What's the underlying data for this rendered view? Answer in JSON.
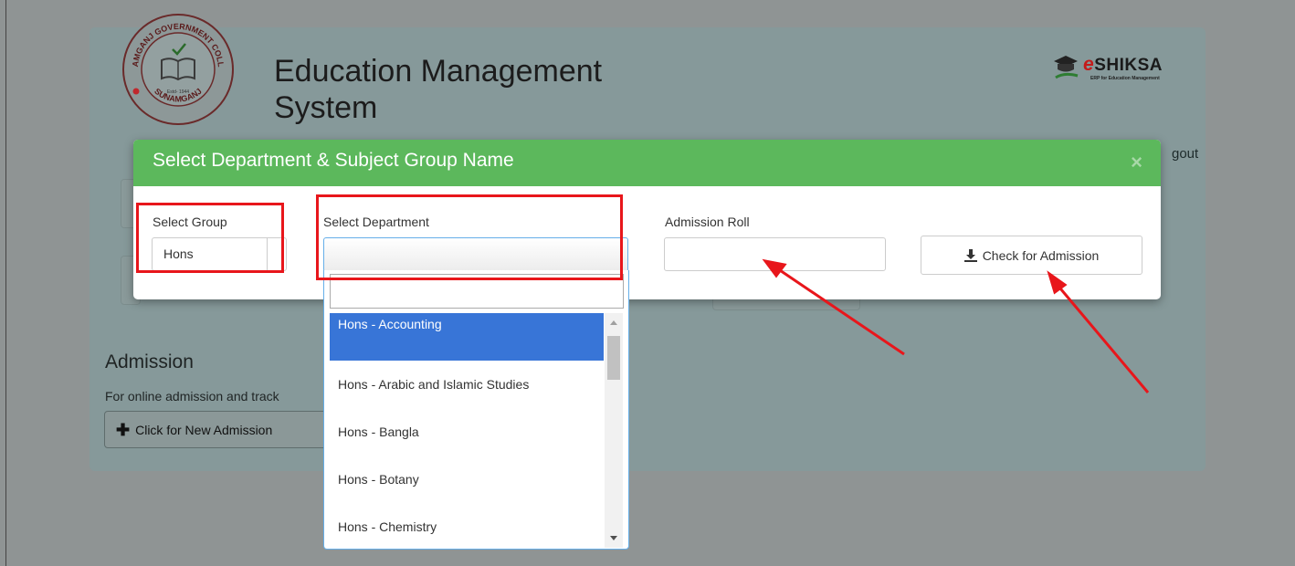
{
  "app": {
    "title": "Education Management System",
    "logout_label": "gout",
    "logo": {
      "top_text": "SUNAMGANJ GOVERNMENT COLLEGE",
      "bottom_text": "SUNAMGANJ",
      "established": "Estd- 1944"
    },
    "brand": {
      "name_prefix": "e",
      "name_rest": "SHIKSA",
      "tagline": "ERP for Education Management"
    }
  },
  "admission": {
    "heading": "Admission",
    "description": "For online admission and track",
    "new_admission_button": "Click for New Admission"
  },
  "modal": {
    "title": "Select Department & Subject Group Name",
    "close_icon": "×",
    "group": {
      "label": "Select Group",
      "value": "Hons"
    },
    "department": {
      "label": "Select Department",
      "value": "",
      "search_value": "",
      "options": [
        "Hons - Accounting",
        "Hons - Arabic and Islamic Studies",
        "Hons - Bangla",
        "Hons - Botany",
        "Hons - Chemistry"
      ],
      "highlighted_option": "Hons - Accounting"
    },
    "admission_roll": {
      "label": "Admission Roll",
      "value": ""
    },
    "check_button": {
      "label": "Check for Admission",
      "icon": "download-icon"
    }
  },
  "colors": {
    "modal_header": "#5cb85c",
    "highlight": "#3875d7",
    "annotation": "#e8161b"
  }
}
